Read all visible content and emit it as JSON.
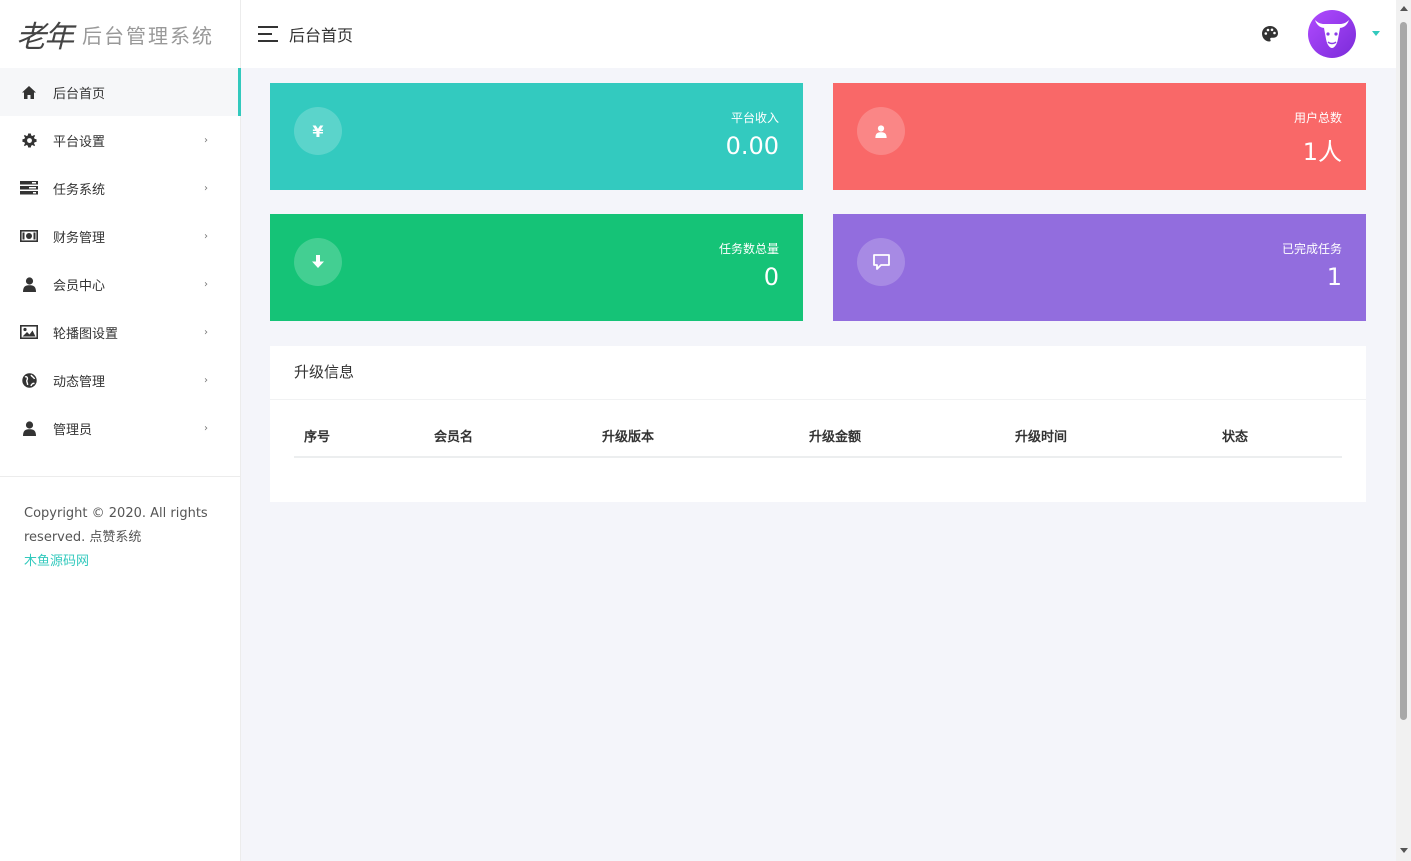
{
  "brand": {
    "mark": "老年",
    "title": "后台管理系统"
  },
  "header": {
    "page_title": "后台首页"
  },
  "sidebar": {
    "items": [
      {
        "label": "后台首页",
        "icon": "home-icon",
        "active": true
      },
      {
        "label": "平台设置",
        "icon": "gear-icon"
      },
      {
        "label": "任务系统",
        "icon": "tasks-icon"
      },
      {
        "label": "财务管理",
        "icon": "money-icon"
      },
      {
        "label": "会员中心",
        "icon": "user-icon"
      },
      {
        "label": "轮播图设置",
        "icon": "image-icon"
      },
      {
        "label": "动态管理",
        "icon": "globe-icon"
      },
      {
        "label": "管理员",
        "icon": "user-icon"
      }
    ],
    "arrow": "›",
    "copyright": "Copyright © 2020. All rights reserved. 点赞系统",
    "copyright_link": "木鱼源码网"
  },
  "stats": [
    {
      "label": "平台收入",
      "value": "0.00",
      "icon_text": "¥",
      "color": "#33cabf"
    },
    {
      "label": "用户总数",
      "value": "1人",
      "icon": "user-icon",
      "color": "#f96868"
    },
    {
      "label": "任务数总量",
      "value": "0",
      "icon": "download-icon",
      "color": "#15c377"
    },
    {
      "label": "已完成任务",
      "value": "1",
      "icon": "comment-icon",
      "color": "#926dde"
    }
  ],
  "upgrade_panel": {
    "title": "升级信息",
    "columns": [
      "序号",
      "会员名",
      "升级版本",
      "升级金额",
      "升级时间",
      "状态"
    ]
  }
}
